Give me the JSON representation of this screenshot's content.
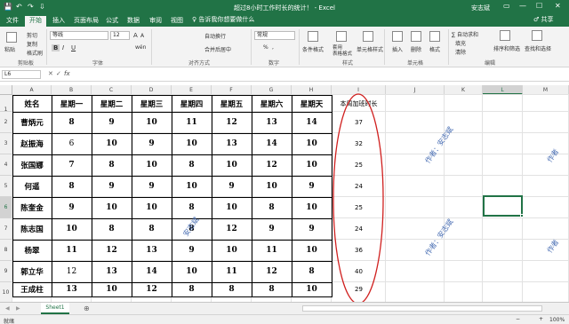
{
  "window": {
    "title": "超过8小时工作时长的统计！ - Excel",
    "user": "安志斌",
    "save_icon": "💾",
    "undo_icon": "↶",
    "redo_icon": "↷",
    "customize_icon": "⇩",
    "restore_icon": "▭",
    "minimize_icon": "—",
    "maximize_icon": "☐",
    "close_icon": "✕"
  },
  "menu": {
    "tabs": [
      "文件",
      "开始",
      "插入",
      "页面布局",
      "公式",
      "数据",
      "审阅",
      "视图"
    ],
    "tell_me": "♀ 告诉我你想要做什么",
    "share": "♂ 共享"
  },
  "ribbon": {
    "clipboard": {
      "paste": "粘贴",
      "cut": "剪切",
      "copy": "复制",
      "format_painter": "格式刷",
      "label": "剪贴板"
    },
    "font": {
      "name": "等线",
      "size": "12",
      "grow": "A",
      "shrink": "A",
      "bold": "B",
      "italic": "I",
      "underline": "U",
      "wen": "wén",
      "label": "字体"
    },
    "alignment": {
      "wrap": "自动换行",
      "merge": "合并后居中",
      "label": "对齐方式"
    },
    "number": {
      "format": "常规",
      "percent": "%",
      "comma": ",",
      "label": "数字"
    },
    "styles": {
      "conditional": "条件格式",
      "table": "套用\n表格格式",
      "cell_styles": "单元格样式",
      "label": "样式"
    },
    "cells": {
      "insert": "插入",
      "delete": "删除",
      "format": "格式",
      "label": "单元格"
    },
    "editing": {
      "autosum": "∑ 自动求和",
      "fill": "填充",
      "clear": "清除",
      "sort": "排序和筛选",
      "find": "查找和选择",
      "label": "编辑"
    }
  },
  "formula_bar": {
    "name_box": "L6",
    "cancel": "✕",
    "enter": "✓",
    "fx": "fx",
    "value": ""
  },
  "columns": [
    "A",
    "B",
    "C",
    "D",
    "E",
    "F",
    "G",
    "H",
    "I",
    "J",
    "K",
    "L",
    "M"
  ],
  "rows": [
    "1",
    "2",
    "3",
    "4",
    "5",
    "6",
    "7",
    "8",
    "9",
    "10"
  ],
  "table": {
    "headers": [
      "姓名",
      "星期一",
      "星期二",
      "星期三",
      "星期四",
      "星期五",
      "星期六",
      "星期天"
    ],
    "rows": [
      [
        "曹炳元",
        "8",
        "9",
        "10",
        "11",
        "12",
        "13",
        "14"
      ],
      [
        "赵振海",
        "6",
        "10",
        "9",
        "10",
        "13",
        "14",
        "10"
      ],
      [
        "张国娜",
        "7",
        "8",
        "10",
        "8",
        "10",
        "12",
        "10"
      ],
      [
        "何遥",
        "8",
        "9",
        "9",
        "10",
        "9",
        "10",
        "9"
      ],
      [
        "陈奎金",
        "9",
        "10",
        "10",
        "8",
        "10",
        "8",
        "10"
      ],
      [
        "陈志国",
        "10",
        "8",
        "8",
        "8",
        "12",
        "9",
        "9"
      ],
      [
        "杨翠",
        "11",
        "12",
        "13",
        "9",
        "10",
        "11",
        "10"
      ],
      [
        "郭立华",
        "12",
        "13",
        "14",
        "10",
        "11",
        "12",
        "8"
      ],
      [
        "王成柱",
        "13",
        "10",
        "12",
        "8",
        "8",
        "8",
        "10"
      ]
    ],
    "col_i_header": "本周加班时长",
    "col_i_values": [
      "37",
      "32",
      "25",
      "24",
      "25",
      "24",
      "36",
      "40",
      "29"
    ]
  },
  "watermarks": [
    "作者：安志斌",
    "作者：安志斌",
    "安志斌",
    "作者",
    "作者"
  ],
  "sheet": {
    "nav_left": "◀",
    "nav_right": "▶",
    "tab": "Sheet1",
    "add": "⊕"
  },
  "status": {
    "ready": "就绪",
    "zoom": "100%",
    "zoom_minus": "−",
    "zoom_plus": "+"
  },
  "colors": {
    "excel_green": "#217346",
    "ellipse_red": "#d0201f",
    "watermark_blue": "#4a6fb4"
  }
}
